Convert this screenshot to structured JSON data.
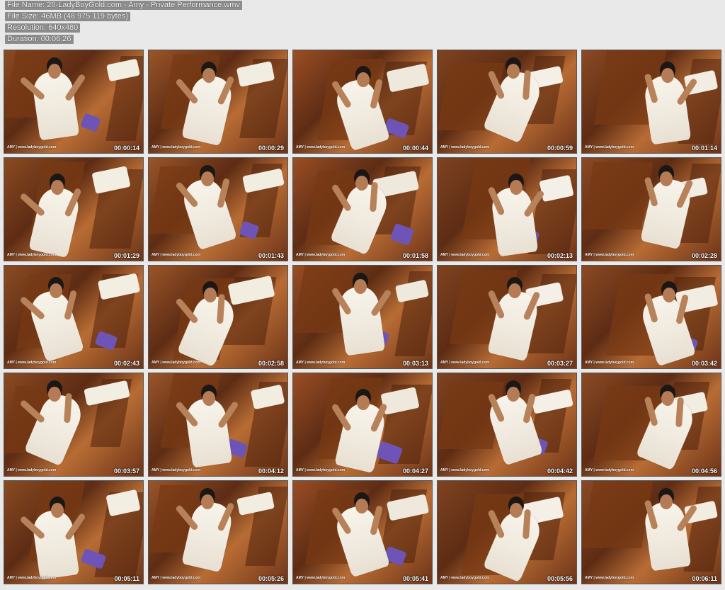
{
  "header": {
    "file_name": "File Name: 20-LadyBoyGold.com - Amy - Private Performance.wmv",
    "file_size": "File Size: 46MB (48 975 119 bytes)",
    "resolution": "Resolution: 640x480",
    "duration": "Duration: 00:06:26"
  },
  "thumbnails": [
    {
      "time": "00:00:14",
      "watermark": "AMY | www.ladyboygold.com",
      "bg": "#8a4b22",
      "accent": "#f2eee2"
    },
    {
      "time": "00:00:29",
      "watermark": "AMY | www.ladyboygold.com",
      "bg": "#9a5528",
      "accent": "#f1ede0"
    },
    {
      "time": "00:00:44",
      "watermark": "AMY | www.ladyboygold.com",
      "bg": "#9a4e24",
      "accent": "#efe9dd"
    },
    {
      "time": "00:00:59",
      "watermark": "AMY | www.ladyboygold.com",
      "bg": "#7f4320",
      "accent": "#f4f0e8"
    },
    {
      "time": "00:01:14",
      "watermark": "AMY | www.ladyboygold.com",
      "bg": "#8b4a24",
      "accent": "#f2ede3"
    },
    {
      "time": "00:01:29",
      "watermark": "AMY | www.ladyboygold.com",
      "bg": "#8a4b22",
      "accent": "#f2eee2"
    },
    {
      "time": "00:01:43",
      "watermark": "AMY | www.ladyboygold.com",
      "bg": "#9a5528",
      "accent": "#f1ede0"
    },
    {
      "time": "00:01:58",
      "watermark": "AMY | www.ladyboygold.com",
      "bg": "#9a4e24",
      "accent": "#efe9dd"
    },
    {
      "time": "00:02:13",
      "watermark": "AMY | www.ladyboygold.com",
      "bg": "#7f4320",
      "accent": "#f4f0e8"
    },
    {
      "time": "00:02:28",
      "watermark": "AMY | www.ladyboygold.com",
      "bg": "#8b4a24",
      "accent": "#f2ede3"
    },
    {
      "time": "00:02:43",
      "watermark": "AMY | www.ladyboygold.com",
      "bg": "#8a4b22",
      "accent": "#f2eee2"
    },
    {
      "time": "00:02:58",
      "watermark": "AMY | www.ladyboygold.com",
      "bg": "#9a5528",
      "accent": "#f1ede0"
    },
    {
      "time": "00:03:13",
      "watermark": "AMY | www.ladyboygold.com",
      "bg": "#9a4e24",
      "accent": "#efe9dd"
    },
    {
      "time": "00:03:27",
      "watermark": "AMY | www.ladyboygold.com",
      "bg": "#7f4320",
      "accent": "#f4f0e8"
    },
    {
      "time": "00:03:42",
      "watermark": "AMY | www.ladyboygold.com",
      "bg": "#8b4a24",
      "accent": "#f2ede3"
    },
    {
      "time": "00:03:57",
      "watermark": "AMY | www.ladyboygold.com",
      "bg": "#8a4b22",
      "accent": "#f2eee2"
    },
    {
      "time": "00:04:12",
      "watermark": "AMY | www.ladyboygold.com",
      "bg": "#9a5528",
      "accent": "#f1ede0"
    },
    {
      "time": "00:04:27",
      "watermark": "AMY | www.ladyboygold.com",
      "bg": "#9a4e24",
      "accent": "#efe9dd"
    },
    {
      "time": "00:04:42",
      "watermark": "AMY | www.ladyboygold.com",
      "bg": "#7f4320",
      "accent": "#f4f0e8"
    },
    {
      "time": "00:04:56",
      "watermark": "AMY | www.ladyboygold.com",
      "bg": "#8b4a24",
      "accent": "#f2ede3"
    },
    {
      "time": "00:05:11",
      "watermark": "AMY | www.ladyboygold.com",
      "bg": "#8a4b22",
      "accent": "#f2eee2"
    },
    {
      "time": "00:05:26",
      "watermark": "AMY | www.ladyboygold.com",
      "bg": "#9a5528",
      "accent": "#f1ede0"
    },
    {
      "time": "00:05:41",
      "watermark": "AMY | www.ladyboygold.com",
      "bg": "#9a4e24",
      "accent": "#efe9dd"
    },
    {
      "time": "00:05:56",
      "watermark": "AMY | www.ladyboygold.com",
      "bg": "#7f4320",
      "accent": "#f4f0e8"
    },
    {
      "time": "00:06:11",
      "watermark": "AMY | www.ladyboygold.com",
      "bg": "#8b4a24",
      "accent": "#f2ede3"
    }
  ],
  "colors": {
    "page_background": "#e9e9e9",
    "header_bg": "#8d8d8d",
    "header_text": "#ffffff",
    "wood": "#8a4b22",
    "cushion": "#f1eee2",
    "pillow": "#6d54b6"
  }
}
